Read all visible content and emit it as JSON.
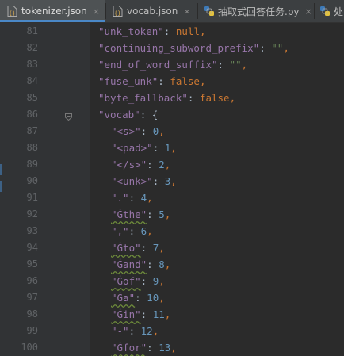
{
  "tabs": [
    {
      "label": "tokenizer.json",
      "close": "×",
      "icon": "json-file-icon",
      "active": true
    },
    {
      "label": "vocab.json",
      "close": "×",
      "icon": "json-file-icon",
      "active": false
    },
    {
      "label": "抽取式回答任务.py",
      "close": "×",
      "icon": "python-file-icon",
      "active": false
    },
    {
      "label": "处",
      "close": "",
      "icon": "python-file-icon",
      "active": false
    }
  ],
  "colors": {
    "background": "#2b2b2b",
    "gutter": "#313335",
    "key": "#9876aa",
    "string": "#6a8759",
    "number": "#6897bb",
    "keyword": "#cc7832",
    "punctuation": "#a9b7c6",
    "active_tab_underline": "#4a88c7"
  },
  "lines": [
    {
      "num": "81",
      "key": "\"unk_token\"",
      "sep": ": ",
      "value": "null",
      "vtype": "kw",
      "end": ","
    },
    {
      "num": "82",
      "key": "\"continuing_subword_prefix\"",
      "sep": ": ",
      "value": "\"\"",
      "vtype": "s",
      "end": ","
    },
    {
      "num": "83",
      "key": "\"end_of_word_suffix\"",
      "sep": ": ",
      "value": "\"\"",
      "vtype": "s",
      "end": ","
    },
    {
      "num": "84",
      "key": "\"fuse_unk\"",
      "sep": ": ",
      "value": "false",
      "vtype": "kw",
      "end": ","
    },
    {
      "num": "85",
      "key": "\"byte_fallback\"",
      "sep": ": ",
      "value": "false",
      "vtype": "kw",
      "end": ","
    },
    {
      "num": "86",
      "key": "\"vocab\"",
      "sep": ": ",
      "value": "{",
      "vtype": "p",
      "end": ""
    },
    {
      "num": "87",
      "key": "\"<s>\"",
      "sep": ": ",
      "value": "0",
      "vtype": "n",
      "end": ","
    },
    {
      "num": "88",
      "key": "\"<pad>\"",
      "sep": ": ",
      "value": "1",
      "vtype": "n",
      "end": ","
    },
    {
      "num": "89",
      "key": "\"</s>\"",
      "sep": ": ",
      "value": "2",
      "vtype": "n",
      "end": ","
    },
    {
      "num": "90",
      "key": "\"<unk>\"",
      "sep": ": ",
      "value": "3",
      "vtype": "n",
      "end": ","
    },
    {
      "num": "91",
      "key": "\".\"",
      "sep": ": ",
      "value": "4",
      "vtype": "n",
      "end": ","
    },
    {
      "num": "92",
      "key": "\"Ġthe\"",
      "sep": ": ",
      "value": "5",
      "vtype": "n",
      "end": ","
    },
    {
      "num": "93",
      "key": "\",\"",
      "sep": ": ",
      "value": "6",
      "vtype": "n",
      "end": ","
    },
    {
      "num": "94",
      "key": "\"Ġto\"",
      "sep": ": ",
      "value": "7",
      "vtype": "n",
      "end": ","
    },
    {
      "num": "95",
      "key": "\"Ġand\"",
      "sep": ": ",
      "value": "8",
      "vtype": "n",
      "end": ","
    },
    {
      "num": "96",
      "key": "\"Ġof\"",
      "sep": ": ",
      "value": "9",
      "vtype": "n",
      "end": ","
    },
    {
      "num": "97",
      "key": "\"Ġa\"",
      "sep": ": ",
      "value": "10",
      "vtype": "n",
      "end": ","
    },
    {
      "num": "98",
      "key": "\"Ġin\"",
      "sep": ": ",
      "value": "11",
      "vtype": "n",
      "end": ","
    },
    {
      "num": "99",
      "key": "\"-\"",
      "sep": ": ",
      "value": "12",
      "vtype": "n",
      "end": ","
    },
    {
      "num": "100",
      "key": "\"Ġfor\"",
      "sep": ": ",
      "value": "13",
      "vtype": "n",
      "end": ","
    }
  ]
}
